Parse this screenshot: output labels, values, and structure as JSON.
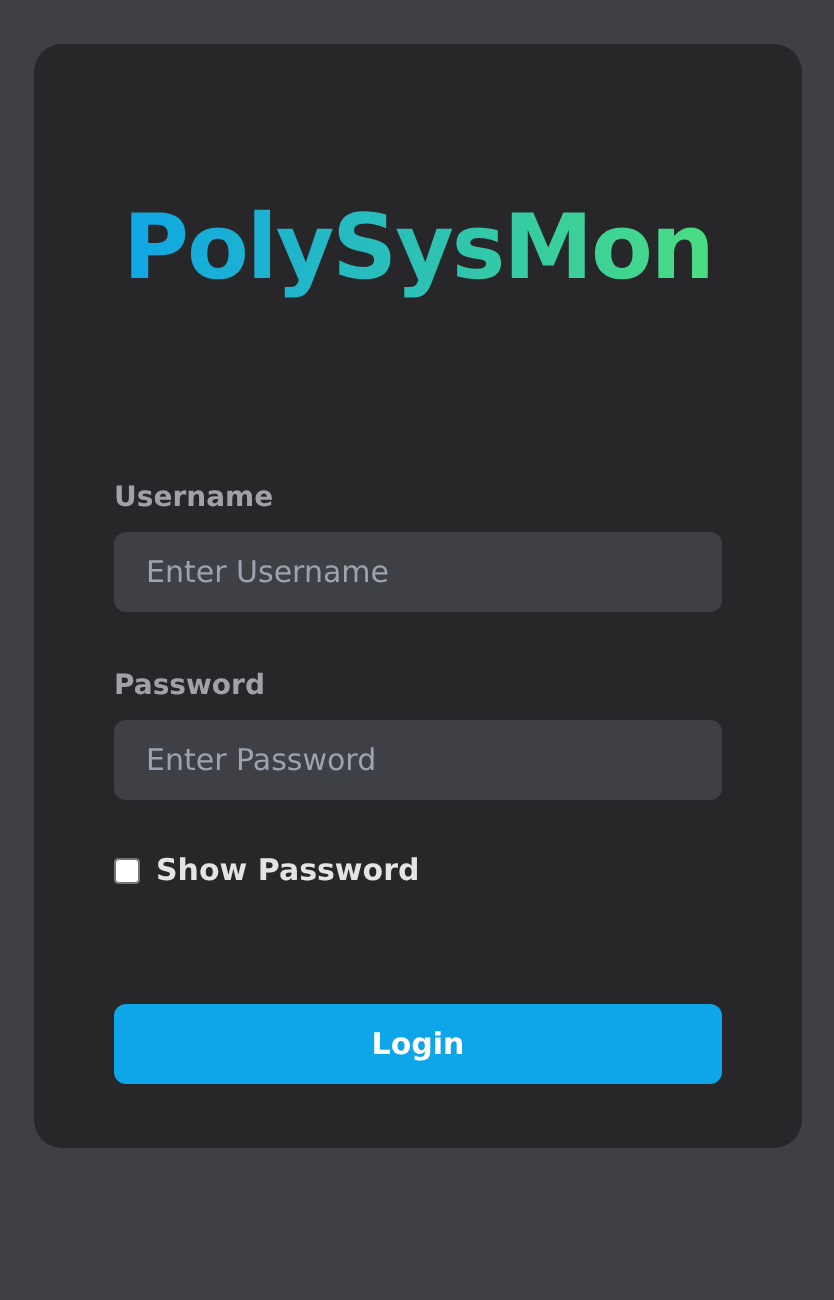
{
  "title": "PolySysMon",
  "fields": [
    {
      "label": "Username",
      "placeholder": "Enter Username"
    },
    {
      "label": "Password",
      "placeholder": "Enter Password"
    }
  ],
  "show_password": {
    "label": "Show Password",
    "checked": false
  },
  "login_button": "Login"
}
